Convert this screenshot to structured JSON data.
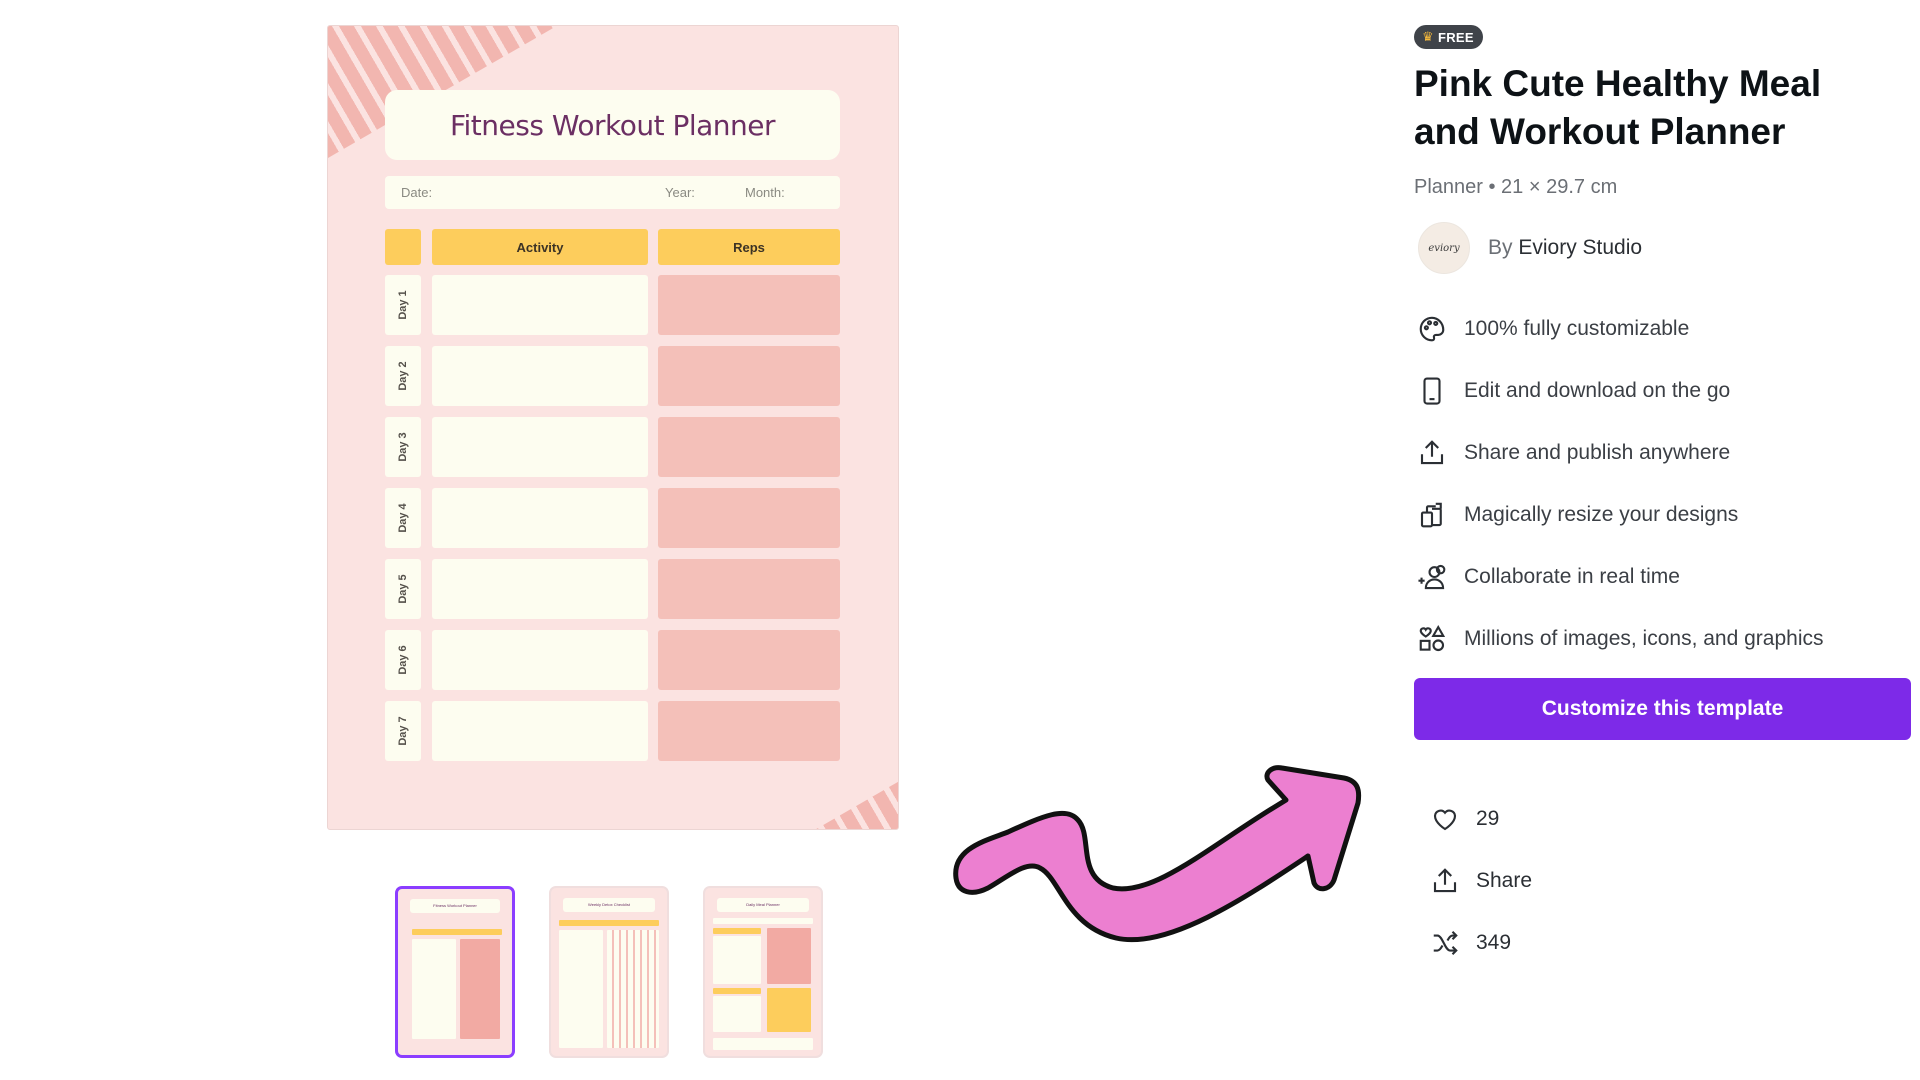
{
  "preview": {
    "title": "Fitness Workout Planner",
    "date_label": "Date:",
    "year_label": "Year:",
    "month_label": "Month:",
    "col_activity": "Activity",
    "col_reps": "Reps",
    "days": [
      "Day 1",
      "Day 2",
      "Day 3",
      "Day 4",
      "Day 5",
      "Day 6",
      "Day 7"
    ]
  },
  "thumbnails": [
    {
      "title": "Fitness Workout Planner",
      "selected": true
    },
    {
      "title": "Weekly Detox Checklist",
      "selected": false
    },
    {
      "title": "Daily Meal Planner",
      "selected": false
    }
  ],
  "details": {
    "badge": "FREE",
    "title": "Pink Cute Healthy Meal and Workout Planner",
    "meta": "Planner • 21 × 29.7 cm",
    "author_prefix": "By",
    "author_name": "Eviory Studio",
    "avatar_text": "eviory",
    "features": [
      {
        "icon": "palette-icon",
        "label": "100% fully customizable"
      },
      {
        "icon": "phone-icon",
        "label": "Edit and download on the go"
      },
      {
        "icon": "upload-icon",
        "label": "Share and publish anywhere"
      },
      {
        "icon": "resize-icon",
        "label": "Magically resize your designs"
      },
      {
        "icon": "collaborate-icon",
        "label": "Collaborate in real time"
      },
      {
        "icon": "shapes-icon",
        "label": "Millions of images, icons, and graphics"
      }
    ],
    "cta_label": "Customize this template",
    "stats": {
      "likes": "29",
      "share": "Share",
      "remixes": "349"
    }
  },
  "colors": {
    "accent": "#7d2ae8",
    "arrow": "#ec7fd0",
    "preview_bg": "#fbe3e1",
    "header_yellow": "#fdcd5c",
    "reps_pink": "#f4c0b9"
  }
}
